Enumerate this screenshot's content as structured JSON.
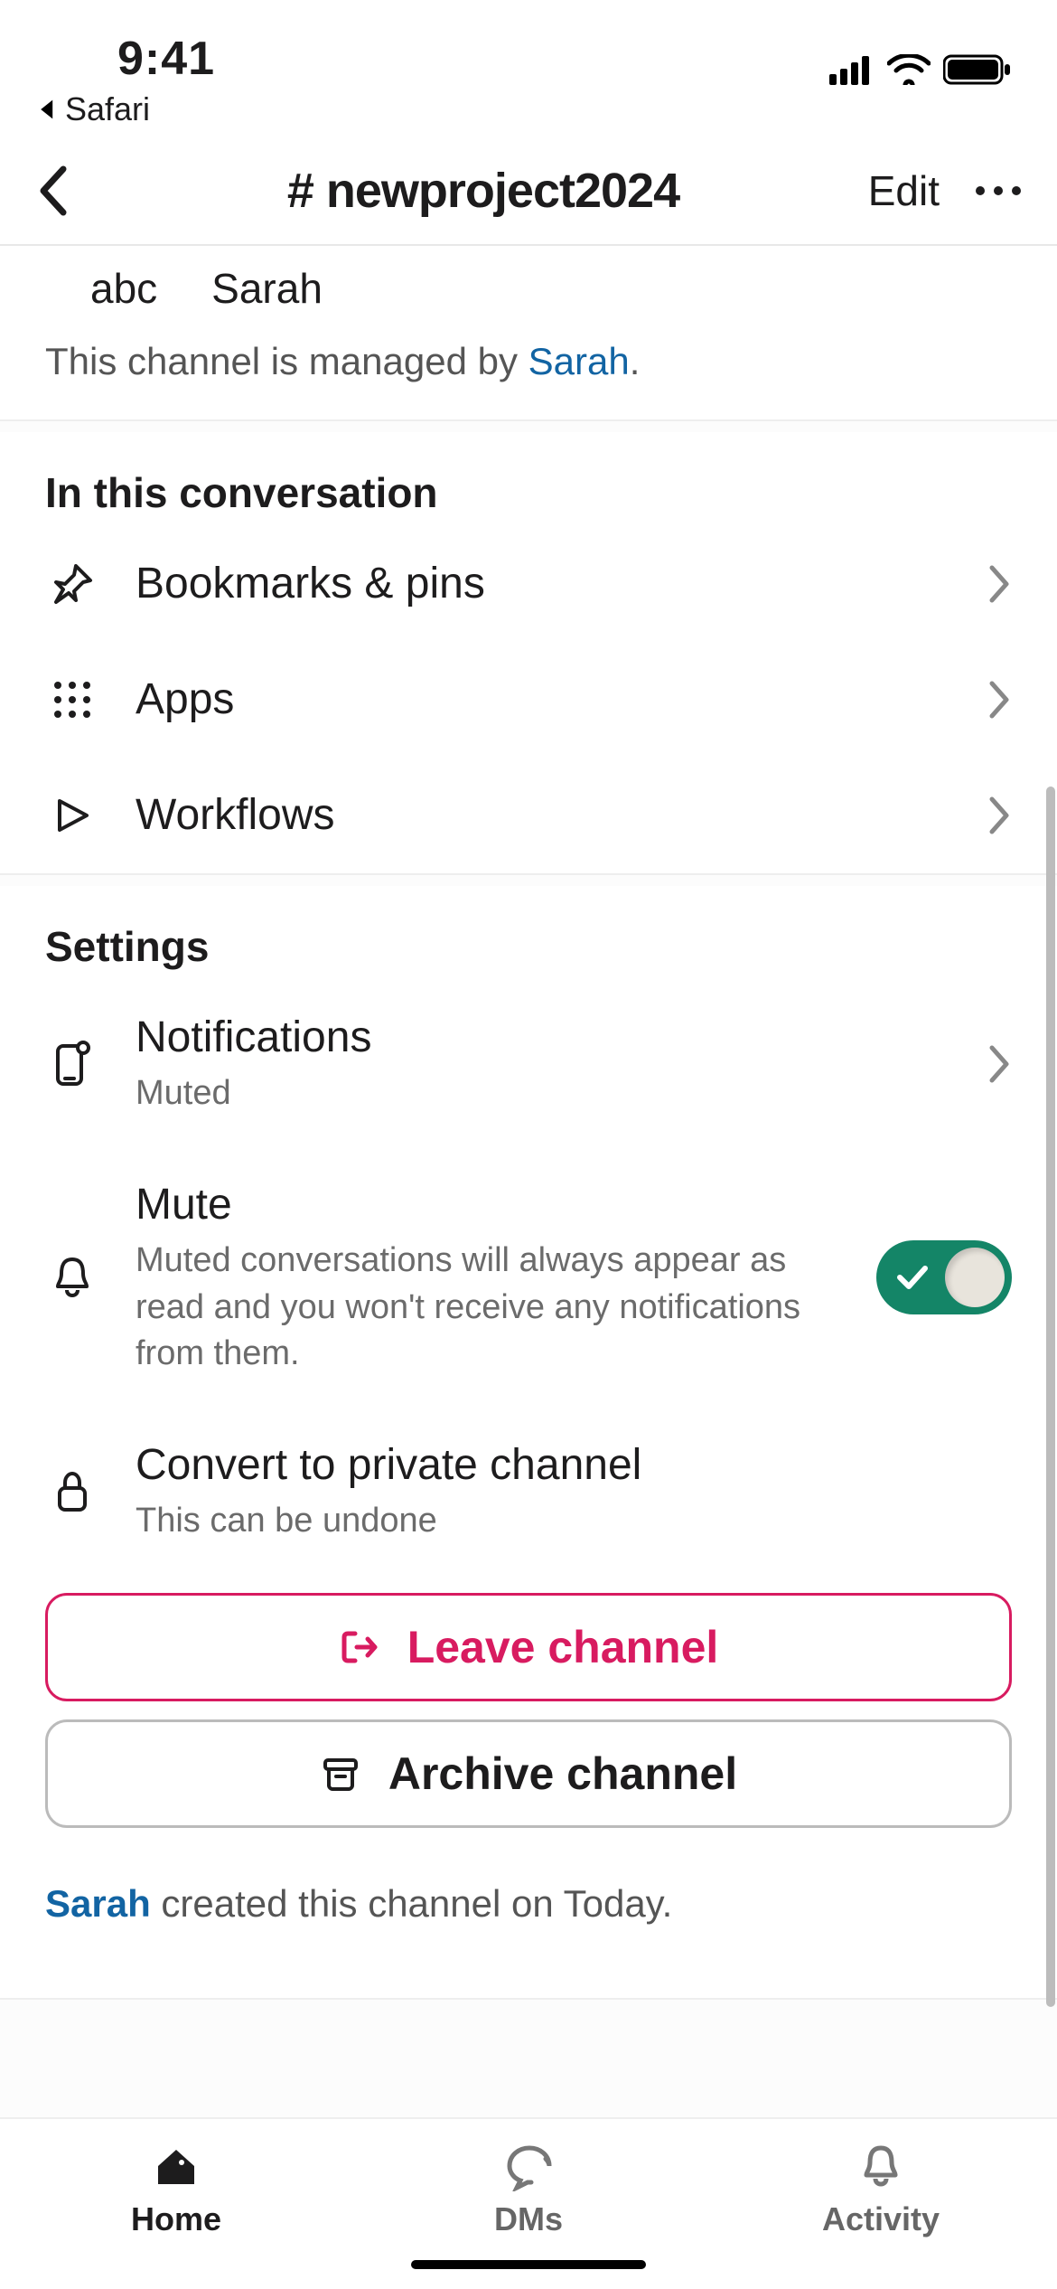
{
  "status": {
    "time": "9:41",
    "breadcrumb": "Safari"
  },
  "nav": {
    "title": "# newproject2024",
    "edit": "Edit"
  },
  "members": {
    "user1": "abc",
    "user2": "Sarah"
  },
  "managed": {
    "prefix": "This channel is managed by ",
    "owner": "Sarah",
    "suffix": "."
  },
  "section1": {
    "title": "In this conversation",
    "bookmarks": "Bookmarks & pins",
    "apps": "Apps",
    "workflows": "Workflows"
  },
  "section2": {
    "title": "Settings",
    "notifications": {
      "title": "Notifications",
      "sub": "Muted"
    },
    "mute": {
      "title": "Mute",
      "sub": "Muted conversations will always appear as read and you won't receive any notifications from them.",
      "on": true
    },
    "convert": {
      "title": "Convert to private channel",
      "sub": "This can be undone"
    }
  },
  "actions": {
    "leave": "Leave channel",
    "archive": "Archive channel"
  },
  "footer": {
    "creator": "Sarah",
    "rest": " created this channel on Today."
  },
  "tabs": {
    "home": "Home",
    "dms": "DMs",
    "activity": "Activity"
  }
}
